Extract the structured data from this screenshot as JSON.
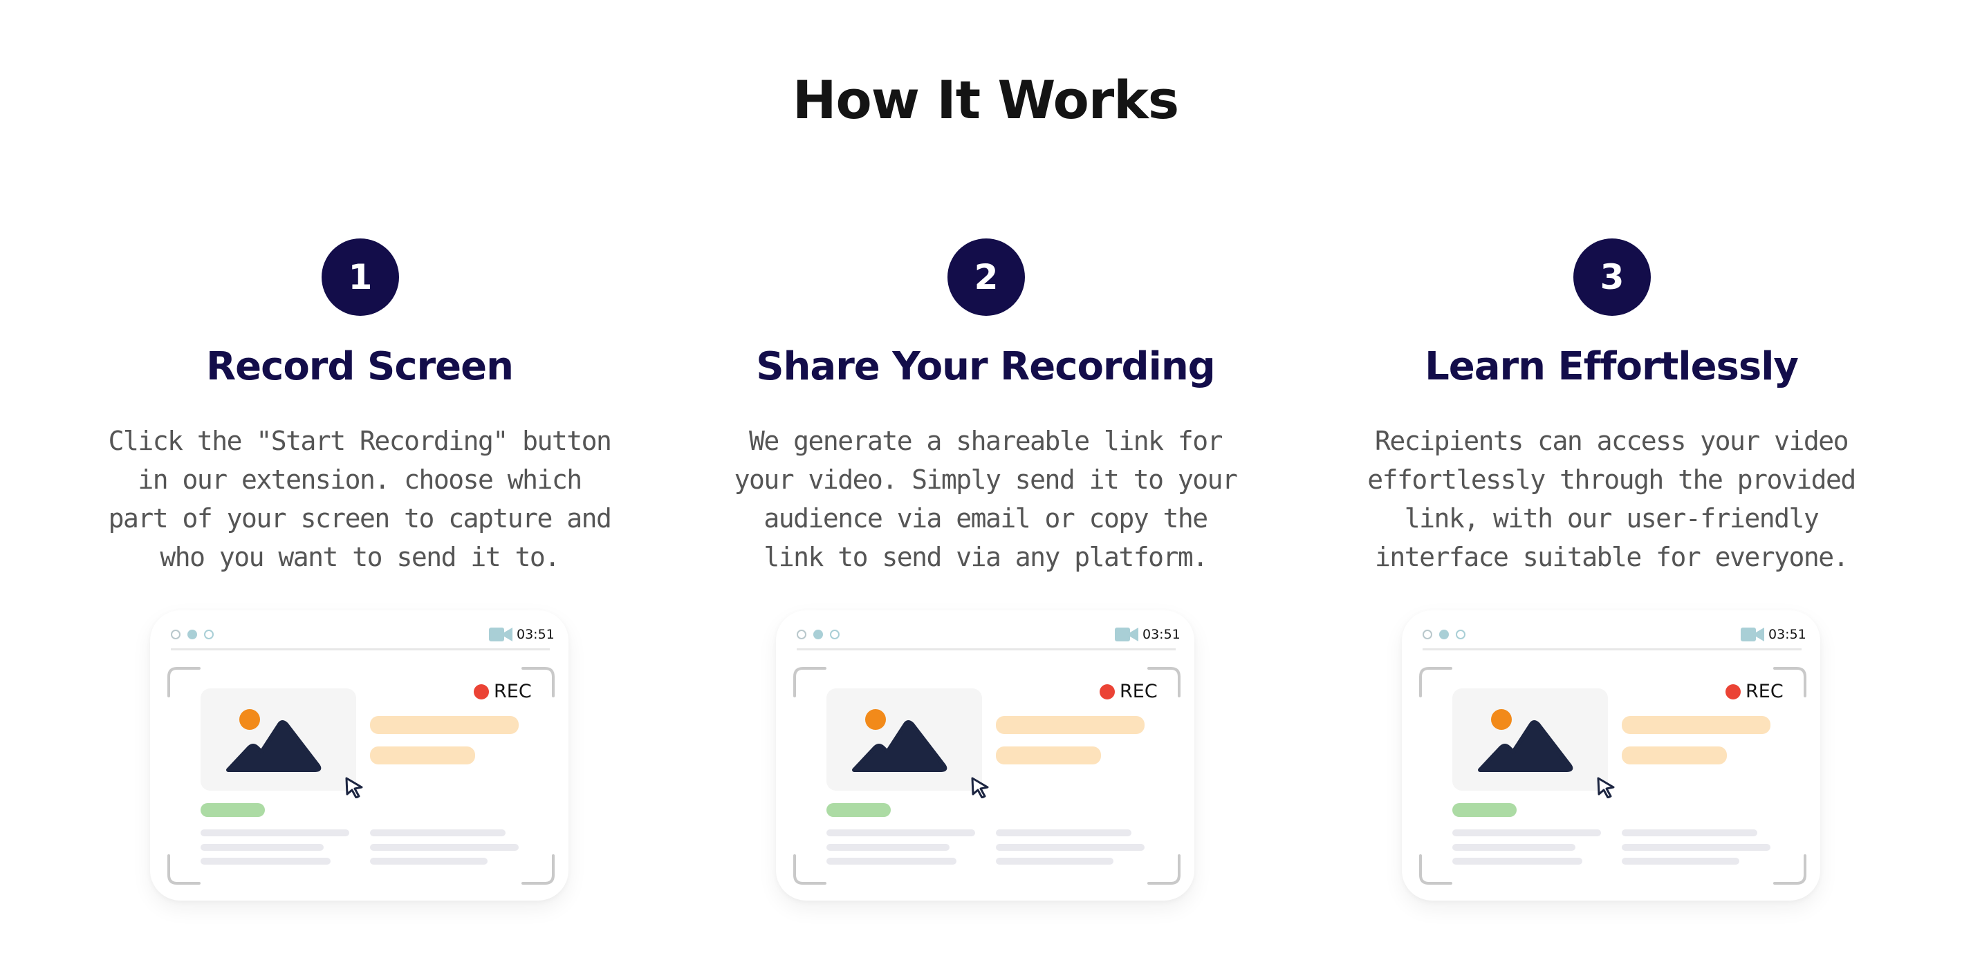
{
  "section": {
    "title": "How It Works"
  },
  "steps": [
    {
      "number": "1",
      "title": "Record Screen",
      "description": "Click the \"Start Recording\" button in our extension. choose which part of your screen to capture and who you want to send it to."
    },
    {
      "number": "2",
      "title": "Share Your Recording",
      "description": "We generate a shareable link for your video. Simply send it to your audience via email or copy the link to send via any platform."
    },
    {
      "number": "3",
      "title": "Learn Effortlessly",
      "description": "Recipients can access your video effortlessly through the provided link, with our user-friendly interface suitable for everyone."
    }
  ],
  "mockup": {
    "timer": "03:51",
    "rec_label": "REC",
    "icons": [
      "video-camera-icon",
      "image-placeholder-icon",
      "cursor-arrow-icon"
    ],
    "colors": {
      "brand_navy": "#130d4a",
      "rec_red": "#eb4335",
      "sun_orange": "#f28a1a",
      "accent_peach": "#fde2bb",
      "accent_green": "#acdba4",
      "camera_teal": "#a9cfd6"
    }
  }
}
